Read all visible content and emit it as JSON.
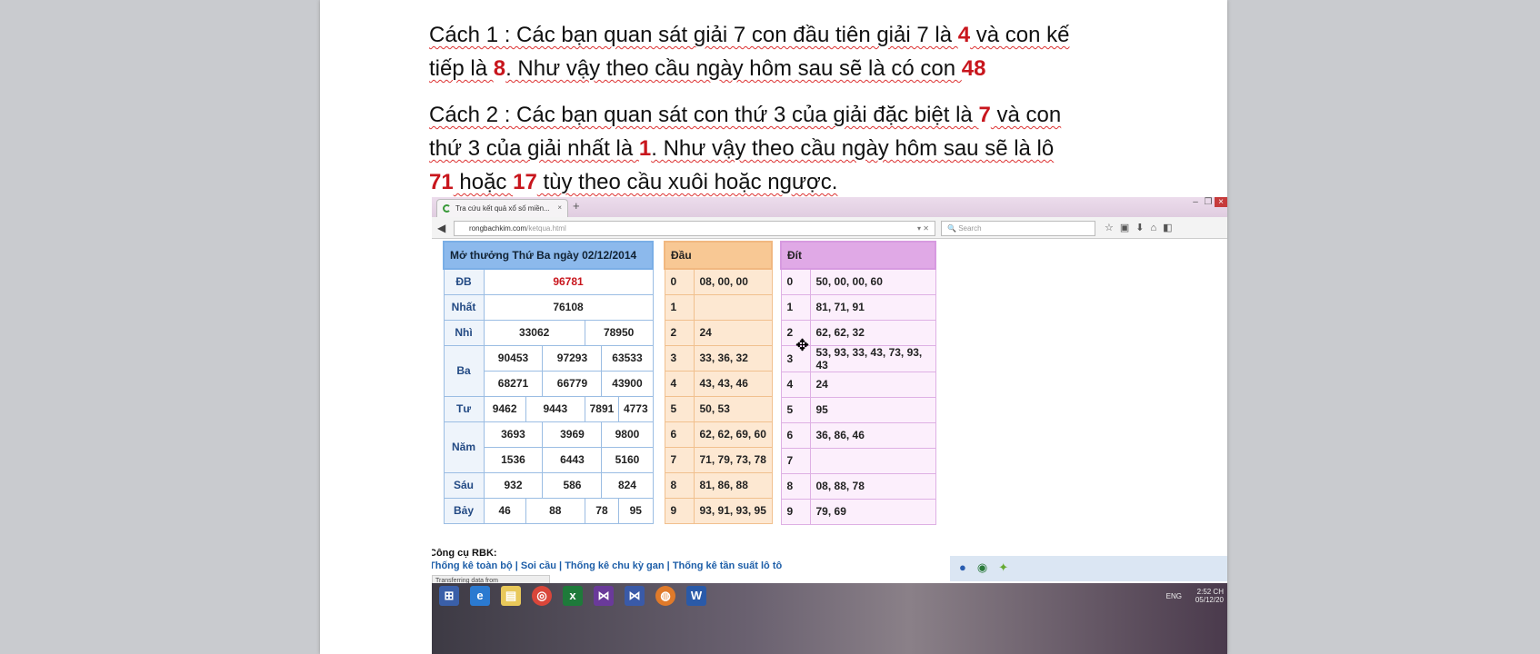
{
  "doc": {
    "p1": [
      "Cách 1 : Các bạn quan sát giải 7 con đầu tiên giải 7 là ",
      "4",
      " và con kế tiếp là ",
      "8",
      ". Như vậy theo cầu ngày hôm sau sẽ là có con ",
      "48"
    ],
    "p2": [
      "Cách 2 : Các bạn quan sát con thứ 3 của giải đặc biệt là ",
      "7",
      " và con thứ 3 của giải nhất là ",
      "1",
      ". Như vậy theo cầu ngày hôm sau sẽ là lô ",
      "71",
      " hoặc ",
      "17",
      " tùy theo cầu xuôi hoặc ngược."
    ]
  },
  "browser": {
    "tab_title": "Tra cứu kết quả xổ số miền...",
    "url_domain": "rongbachkim.com",
    "url_path": "/ketqua.html",
    "search_placeholder": "Search",
    "status": "Transferring data from widget.adnet.vn..."
  },
  "results": {
    "title": "Mở thưởng Thứ Ba ngày 02/12/2014",
    "rows": [
      {
        "label": "ĐB",
        "values": [
          "96781"
        ]
      },
      {
        "label": "Nhất",
        "values": [
          "76108"
        ]
      },
      {
        "label": "Nhì",
        "values": [
          "33062",
          "78950"
        ]
      },
      {
        "label": "Ba",
        "values": [
          "90453",
          "97293",
          "63533",
          "68271",
          "66779",
          "43900"
        ]
      },
      {
        "label": "Tư",
        "values": [
          "9462",
          "9443",
          "7891",
          "4773"
        ]
      },
      {
        "label": "Năm",
        "values": [
          "3693",
          "3969",
          "9800",
          "1536",
          "6443",
          "5160"
        ]
      },
      {
        "label": "Sáu",
        "values": [
          "932",
          "586",
          "824"
        ]
      },
      {
        "label": "Bảy",
        "values": [
          "46",
          "88",
          "78",
          "95"
        ]
      }
    ]
  },
  "dau": {
    "title": "Đầu",
    "rows": [
      [
        "0",
        "08, 00, 00"
      ],
      [
        "1",
        ""
      ],
      [
        "2",
        "24"
      ],
      [
        "3",
        "33, 36, 32"
      ],
      [
        "4",
        "43, 43, 46"
      ],
      [
        "5",
        "50, 53"
      ],
      [
        "6",
        "62, 62, 69, 60"
      ],
      [
        "7",
        "71, 79, 73, 78"
      ],
      [
        "8",
        "81, 86, 88"
      ],
      [
        "9",
        "93, 91, 93, 95"
      ]
    ]
  },
  "dit": {
    "title": "Đít",
    "rows": [
      [
        "0",
        "50, 00, 00, 60"
      ],
      [
        "1",
        "81, 71, 91"
      ],
      [
        "2",
        "62, 62, 32"
      ],
      [
        "3",
        "53, 93, 33, 43, 73, 93, 43"
      ],
      [
        "4",
        "24"
      ],
      [
        "5",
        "95"
      ],
      [
        "6",
        "36, 86, 46"
      ],
      [
        "7",
        ""
      ],
      [
        "8",
        "08, 88, 78"
      ],
      [
        "9",
        "79, 69"
      ]
    ]
  },
  "tools": {
    "title": "Công cụ RBK:",
    "links": [
      "Thống kê toàn bộ",
      "Soi cầu",
      "Thống kê chu kỳ gan",
      "Thống kê tần suất lô tô"
    ],
    "sep": " | "
  },
  "taskbar": {
    "lang": "ENG",
    "time": "2:52 CH",
    "date": "05/12/20"
  }
}
